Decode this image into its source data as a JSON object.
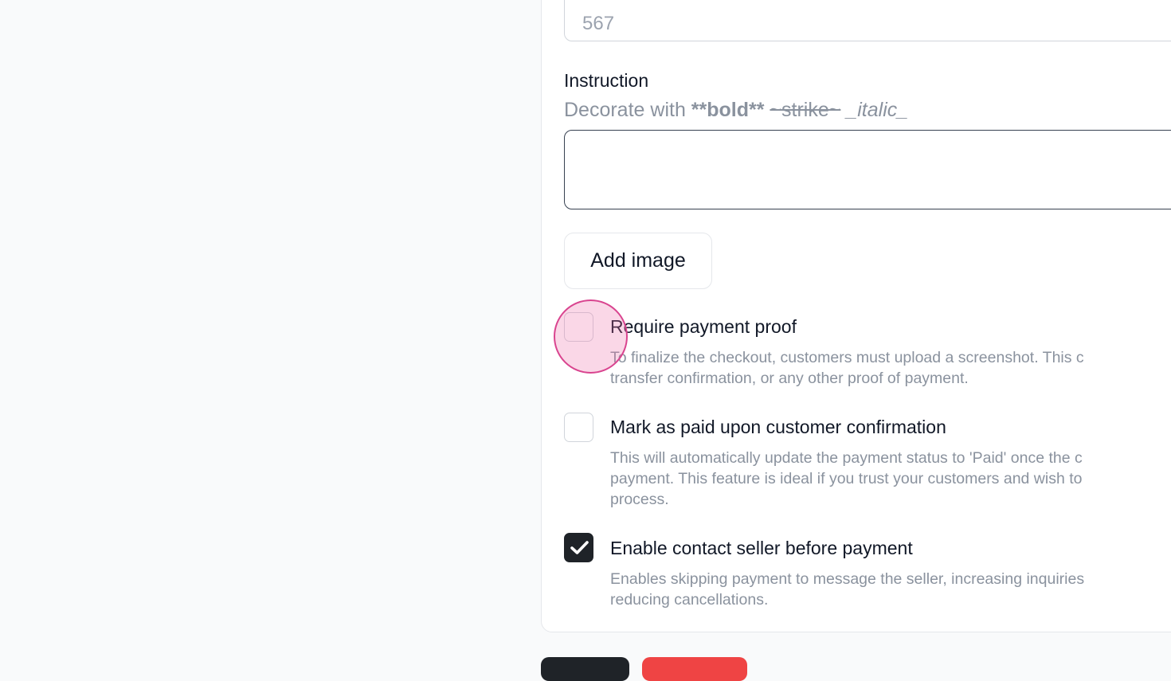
{
  "top_input": {
    "placeholder": "567"
  },
  "instruction": {
    "label": "Instruction",
    "hint_prefix": "Decorate with ",
    "hint_bold": "**bold**",
    "hint_strike": "~strike~",
    "hint_italic": "_italic_"
  },
  "add_image_label": "Add image",
  "options": [
    {
      "title": "Require payment proof",
      "description": "To finalize the checkout, customers must upload a screenshot. This c\ntransfer confirmation, or any other proof of payment.",
      "checked": false
    },
    {
      "title": "Mark as paid upon customer confirmation",
      "description": "This will automatically update the payment status to 'Paid' once the c\npayment. This feature is ideal if you trust your customers and wish to\nprocess.",
      "checked": false
    },
    {
      "title": "Enable contact seller before payment",
      "description": "Enables skipping payment to message the seller, increasing inquiries\nreducing cancellations.",
      "checked": true
    }
  ],
  "icons": {
    "check": "check-icon"
  },
  "colors": {
    "checked_bg": "#1f2328",
    "danger": "#ef4444",
    "click_highlight": "#d9448f"
  }
}
